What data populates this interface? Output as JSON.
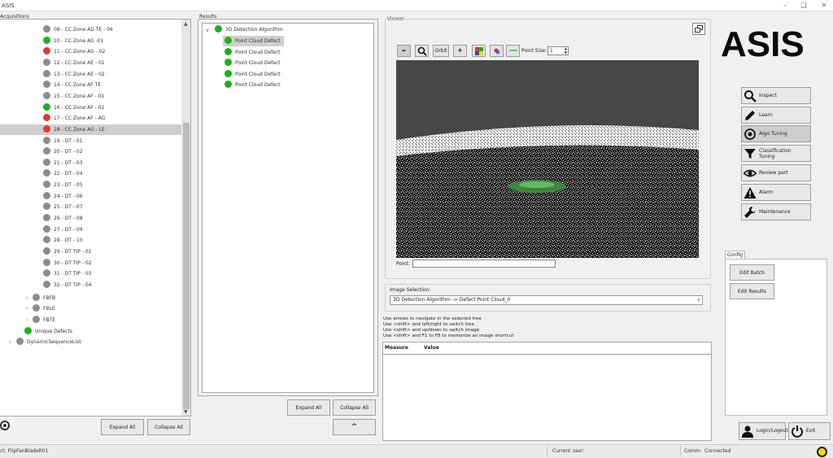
{
  "window": {
    "title": "ASIS"
  },
  "acquisitions": {
    "label": "Acquisitions",
    "items": [
      {
        "label": "08 - CC Zone AD TE - 06",
        "status": "gray"
      },
      {
        "label": "10 - CC Zone AG -01",
        "status": "green"
      },
      {
        "label": "11 - CC Zone AG - 02",
        "status": "red"
      },
      {
        "label": "12 - CC Zone AE - 01",
        "status": "gray"
      },
      {
        "label": "13 - CC Zone AE - 02",
        "status": "gray"
      },
      {
        "label": "14 - CC Zone AF TE",
        "status": "gray"
      },
      {
        "label": "15 - CC Zone AF - 01",
        "status": "gray"
      },
      {
        "label": "16 - CC Zone AF - 02",
        "status": "green"
      },
      {
        "label": "17 - CC Zone AF - AG",
        "status": "red"
      },
      {
        "label": "18 - CC Zone AG - LE",
        "status": "red",
        "selected": true
      },
      {
        "label": "19 - DT - 01",
        "status": "gray"
      },
      {
        "label": "20 - DT - 02",
        "status": "gray"
      },
      {
        "label": "21 - DT - 03",
        "status": "gray"
      },
      {
        "label": "22 - DT - 04",
        "status": "gray"
      },
      {
        "label": "23 - DT - 05",
        "status": "gray"
      },
      {
        "label": "24 - DT - 06",
        "status": "gray"
      },
      {
        "label": "25 - DT - 07",
        "status": "gray"
      },
      {
        "label": "26 - DT - 08",
        "status": "gray"
      },
      {
        "label": "27 - DT - 09",
        "status": "gray"
      },
      {
        "label": "28 - DT - 10",
        "status": "gray"
      },
      {
        "label": "29 - DT TIP - 01",
        "status": "gray"
      },
      {
        "label": "30 - DT TIP - 02",
        "status": "gray"
      },
      {
        "label": "31 - DT TIP - 03",
        "status": "gray"
      },
      {
        "label": "32 - DT TIP - 04",
        "status": "gray"
      }
    ],
    "groups": [
      {
        "label": "FBFB",
        "status": "gray"
      },
      {
        "label": "FBLE",
        "status": "gray"
      },
      {
        "label": "FBTE",
        "status": "gray"
      }
    ],
    "unique_defects": {
      "label": "Unique Defects",
      "status": "green"
    },
    "dynamic": {
      "label": "DynamicSequenceList",
      "status": "gray"
    },
    "expand_all": "Expand All",
    "collapse_all": "Collapse All"
  },
  "results": {
    "label": "Results",
    "root": {
      "label": "3D Detection Algorithm",
      "status": "green"
    },
    "items": [
      {
        "label": "Point Cloud Defect",
        "selected": true
      },
      {
        "label": "Point Cloud Defect"
      },
      {
        "label": "Point Cloud Defect"
      },
      {
        "label": "Point Cloud Defect"
      },
      {
        "label": "Point Cloud Defect"
      }
    ],
    "expand_all": "Expand All",
    "collapse_all": "Collapse All",
    "up_button": "^"
  },
  "viewer": {
    "label": "Viewer",
    "toolbar": {
      "orbit": "Orbit",
      "point_size_label": "Point Size:",
      "point_size_value": "1"
    },
    "point_label": "Point:",
    "point_value": "",
    "image_selection_label": "Image Selection:",
    "image_selection_value": "3D Detection Algorithm -> Defect Point Cloud_0",
    "hints": [
      "Use arrows to navigate in the selected tree",
      "Use <shift> and left/right to switch tree",
      "Use <shift> and up/down to switch image",
      "Use <shift> and F1 to F8 to memorize an image shortcut"
    ],
    "table_headers": [
      "Measure",
      "Value"
    ]
  },
  "logo": "ASIS",
  "nav": [
    {
      "label": "Inspect",
      "icon": "magnifier-icon"
    },
    {
      "label": "Learn",
      "icon": "pencil-icon"
    },
    {
      "label": "Algo Tuning",
      "icon": "target-icon",
      "active": true
    },
    {
      "label": "Classification\nTuning",
      "icon": "funnel-icon"
    },
    {
      "label": "Review part",
      "icon": "eye-icon"
    },
    {
      "label": "Alarm",
      "icon": "warning-icon"
    },
    {
      "label": "Maintenance",
      "icon": "wrench-icon"
    }
  ],
  "config": {
    "tab": "Config",
    "edit_batch": "Edit Batch",
    "edit_results": "Edit Results"
  },
  "user": {
    "login": "Login/Logout",
    "exit": "Exit"
  },
  "status": {
    "product": "ct: FlipFanBladeR01",
    "current_user_label": "Current user:",
    "comm_label": "Comm:",
    "comm_value": "Connected"
  },
  "colors": {
    "accent_green": "#1bb11b",
    "alert_red": "#e03a2e",
    "status_yellow": "#f3d800"
  }
}
